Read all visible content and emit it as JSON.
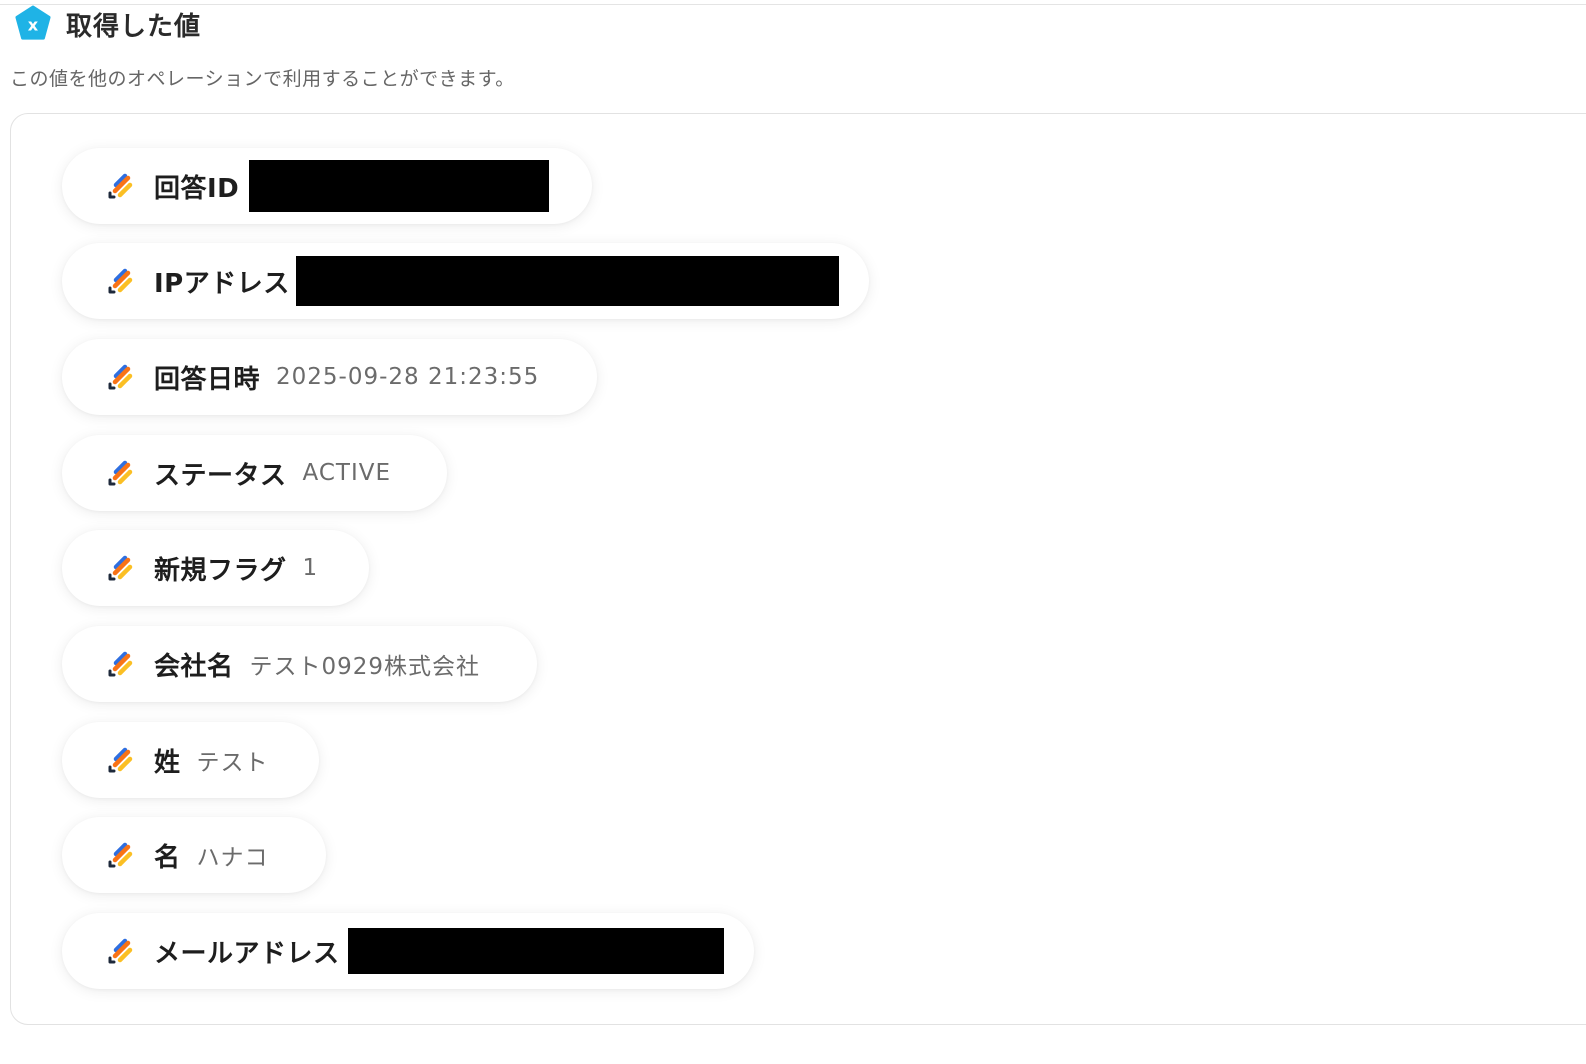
{
  "header": {
    "title": "取得した値",
    "subtitle": "この値を他のオペレーションで利用することができます。",
    "icon": "x-variable-icon",
    "icon_color": "#1fb3e6"
  },
  "fields": [
    {
      "label": "回答ID",
      "value": null,
      "redacted": true
    },
    {
      "label": "IPアドレス",
      "value": null,
      "redacted": true
    },
    {
      "label": "回答日時",
      "value": "2025-09-28 21:23:55",
      "redacted": false
    },
    {
      "label": "ステータス",
      "value": "ACTIVE",
      "redacted": false
    },
    {
      "label": "新規フラグ",
      "value": "1",
      "redacted": false
    },
    {
      "label": "会社名",
      "value": "テスト0929株式会社",
      "redacted": false
    },
    {
      "label": "姓",
      "value": "テスト",
      "redacted": false
    },
    {
      "label": "名",
      "value": "ハナコ",
      "redacted": false
    },
    {
      "label": "メールアドレス",
      "value": null,
      "redacted": true
    }
  ],
  "colors": {
    "accent_blue": "#2f6fe0",
    "accent_orange": "#f97316",
    "accent_yellow": "#fbbf24",
    "accent_navy": "#1e293b"
  }
}
